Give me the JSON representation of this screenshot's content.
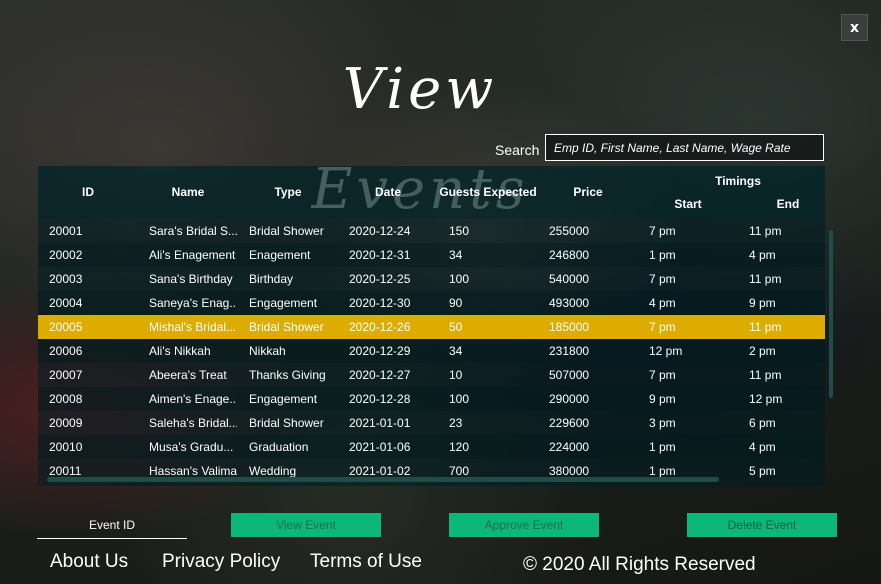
{
  "window": {
    "close_label": "x"
  },
  "title": "View Events",
  "search": {
    "label": "Search",
    "placeholder": "Emp ID, First Name, Last Name, Wage Rate"
  },
  "table": {
    "columns": {
      "id": "ID",
      "name": "Name",
      "type": "Type",
      "date": "Date",
      "guests": "Guests Expected",
      "price": "Price",
      "timings": "Timings",
      "start": "Start",
      "end": "End"
    },
    "rows": [
      [
        "20001",
        "Sara's Bridal S...",
        "Bridal Shower",
        "2020-12-24",
        "150",
        "255000",
        "7 pm",
        "11 pm"
      ],
      [
        "20002",
        "Ali's Enagement",
        "Enagement",
        "2020-12-31",
        "34",
        "246800",
        "1 pm",
        "4 pm"
      ],
      [
        "20003",
        "Sana's Birthday",
        "Birthday",
        "2020-12-25",
        "100",
        "540000",
        "7 pm",
        "11 pm"
      ],
      [
        "20004",
        "Saneya's Enag...",
        "Engagement",
        "2020-12-30",
        "90",
        "493000",
        "4 pm",
        "9 pm"
      ],
      [
        "20005",
        "Mishal's Bridal...",
        "Bridal Shower",
        "2020-12-26",
        "50",
        "185000",
        "7 pm",
        "11 pm"
      ],
      [
        "20006",
        "Ali's Nikkah",
        "Nikkah",
        "2020-12-29",
        "34",
        "231800",
        "12 pm",
        "2 pm"
      ],
      [
        "20007",
        "Abeera's Treat",
        "Thanks Giving",
        "2020-12-27",
        "10",
        "507000",
        "7 pm",
        "11 pm"
      ],
      [
        "20008",
        "Aimen's Enage...",
        "Engagement",
        "2020-12-28",
        "100",
        "290000",
        "9 pm",
        "12 pm"
      ],
      [
        "20009",
        "Saleha's Bridal...",
        "Bridal Shower",
        "2021-01-01",
        "23",
        "229600",
        "3 pm",
        "6 pm"
      ],
      [
        "20010",
        "Musa's Gradu...",
        "Graduation",
        "2021-01-06",
        "120",
        "224000",
        "1 pm",
        "4 pm"
      ],
      [
        "20011",
        "Hassan's Valima",
        "Wedding",
        "2021-01-02",
        "700",
        "380000",
        "1 pm",
        "5 pm"
      ]
    ],
    "selected_index": 4
  },
  "form": {
    "event_id_label": "Event ID",
    "view_button": "View Event",
    "approve_button": "Approve Event",
    "delete_button": "Delete Event"
  },
  "footer": {
    "about": "About Us",
    "privacy": "Privacy Policy",
    "terms": "Terms of Use",
    "copyright": "© 2020 All Rights Reserved"
  },
  "colors": {
    "accent_selected_row": "#ddac00",
    "button_green": "#0db67b"
  }
}
